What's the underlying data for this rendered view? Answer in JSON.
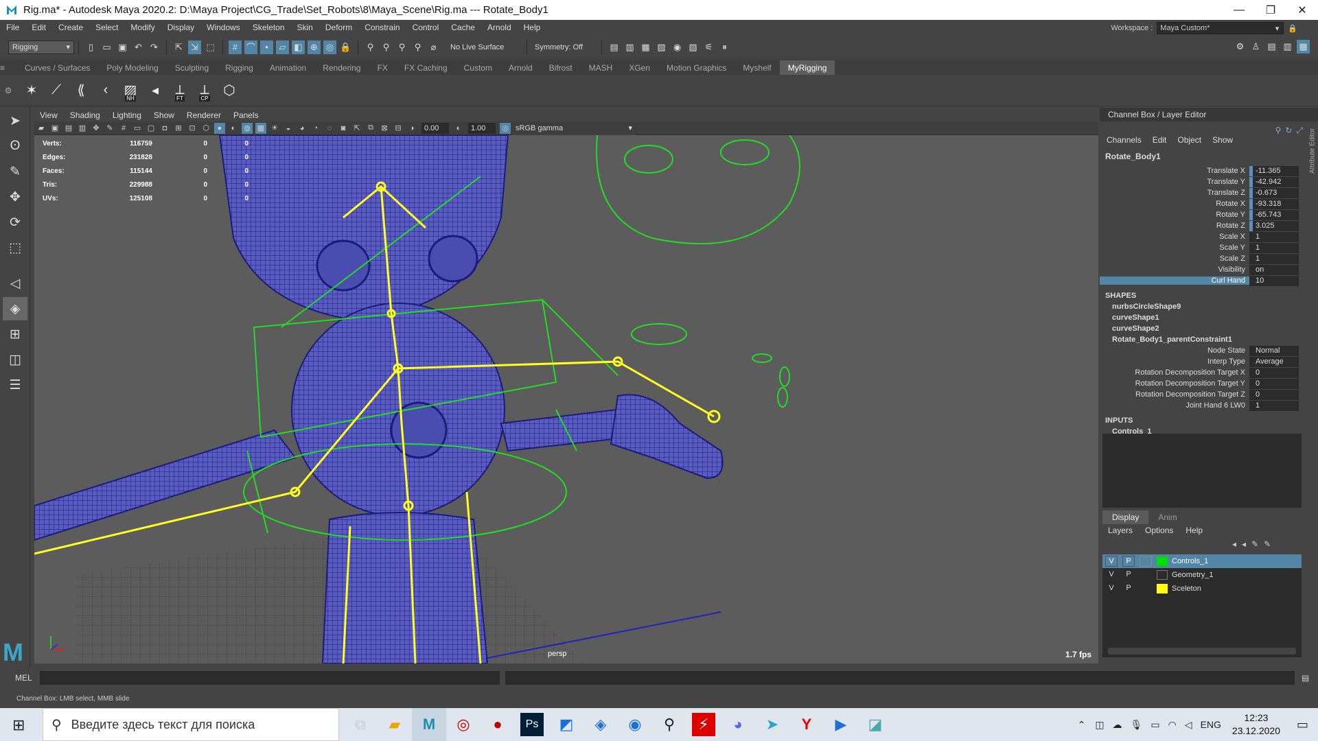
{
  "window": {
    "title": "Rig.ma* - Autodesk Maya 2020.2: D:\\Maya Project\\CG_Trade\\Set_Robots\\8\\Maya_Scene\\Rig.ma    ---    Rotate_Body1",
    "minimize": "—",
    "maximize": "❐",
    "close": "✕"
  },
  "menu": [
    "File",
    "Edit",
    "Create",
    "Select",
    "Modify",
    "Display",
    "Windows",
    "Skeleton",
    "Skin",
    "Deform",
    "Constrain",
    "Control",
    "Cache",
    "Arnold",
    "Help"
  ],
  "workspace": {
    "label": "Workspace :",
    "value": "Maya Custom*"
  },
  "status": {
    "menuset": "Rigging",
    "live_surface": "No Live Surface",
    "symmetry": "Symmetry: Off"
  },
  "shelf_tabs": [
    "Curves / Surfaces",
    "Poly Modeling",
    "Sculpting",
    "Rigging",
    "Animation",
    "Rendering",
    "FX",
    "FX Caching",
    "Custom",
    "Arnold",
    "Bifrost",
    "MASH",
    "XGen",
    "Motion Graphics",
    "Myshelf",
    "MyRigging"
  ],
  "shelf_active": "MyRigging",
  "shelf_badges": {
    "nh": "NH",
    "ft": "FT",
    "cp": "CP"
  },
  "viewport": {
    "menu": [
      "View",
      "Shading",
      "Lighting",
      "Show",
      "Renderer",
      "Panels"
    ],
    "exposure": "0.00",
    "gamma": "1.00",
    "colorspace": "sRGB gamma",
    "camera": "persp",
    "fps": "1.7 fps",
    "hud": [
      {
        "label": "Verts:",
        "a": "116759",
        "b": "0",
        "c": "0"
      },
      {
        "label": "Edges:",
        "a": "231828",
        "b": "0",
        "c": "0"
      },
      {
        "label": "Faces:",
        "a": "115144",
        "b": "0",
        "c": "0"
      },
      {
        "label": "Tris:",
        "a": "229988",
        "b": "0",
        "c": "0"
      },
      {
        "label": "UVs:",
        "a": "125108",
        "b": "0",
        "c": "0"
      }
    ]
  },
  "channel_box": {
    "title": "Channel Box / Layer Editor",
    "menu": [
      "Channels",
      "Edit",
      "Object",
      "Show"
    ],
    "object": "Rotate_Body1",
    "attributes": [
      {
        "name": "Translate X",
        "value": "-11.365"
      },
      {
        "name": "Translate Y",
        "value": "-42.942"
      },
      {
        "name": "Translate Z",
        "value": "-0.673"
      },
      {
        "name": "Rotate X",
        "value": "-93.318"
      },
      {
        "name": "Rotate Y",
        "value": "-65.743"
      },
      {
        "name": "Rotate Z",
        "value": "3.025"
      },
      {
        "name": "Scale X",
        "value": "1"
      },
      {
        "name": "Scale Y",
        "value": "1"
      },
      {
        "name": "Scale Z",
        "value": "1"
      },
      {
        "name": "Visibility",
        "value": "on"
      },
      {
        "name": "Curl Hand",
        "value": "10"
      }
    ],
    "shapes_header": "SHAPES",
    "shapes": [
      "nurbsCircleShape9",
      "curveShape1",
      "curveShape2",
      "Rotate_Body1_parentConstraint1"
    ],
    "constraint_attrs": [
      {
        "name": "Node State",
        "value": "Normal"
      },
      {
        "name": "Interp Type",
        "value": "Average"
      },
      {
        "name": "Rotation Decomposition Target X",
        "value": "0"
      },
      {
        "name": "Rotation Decomposition Target Y",
        "value": "0"
      },
      {
        "name": "Rotation Decomposition Target Z",
        "value": "0"
      },
      {
        "name": "Joint Hand 6 LW0",
        "value": "1"
      }
    ],
    "inputs_header": "INPUTS",
    "inputs": [
      "Controls_1"
    ],
    "attribute_editor_tab": "Attribute Editor"
  },
  "layer_editor": {
    "tabs": [
      "Display",
      "Anim"
    ],
    "menu": [
      "Layers",
      "Options",
      "Help"
    ],
    "layers": [
      {
        "v": "V",
        "p": "P",
        "name": "Controls_1",
        "color": "#00e000"
      },
      {
        "v": "V",
        "p": "P",
        "name": "Geometry_1",
        "color": ""
      },
      {
        "v": "V",
        "p": "P",
        "name": "Sceleton",
        "color": "#ffff00"
      }
    ]
  },
  "command": {
    "mel": "MEL"
  },
  "helpline": "Channel Box: LMB select, MMB slide",
  "taskbar": {
    "search_placeholder": "Введите здесь текст для поиска",
    "lang": "ENG",
    "time": "12:23",
    "date": "23.12.2020"
  }
}
